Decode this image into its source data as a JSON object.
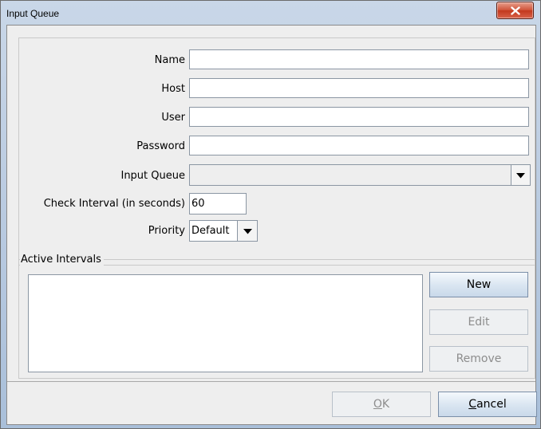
{
  "window": {
    "title": "Input Queue",
    "close_icon": "close-x-icon"
  },
  "form": {
    "name_label": "Name",
    "name_value": "",
    "host_label": "Host",
    "host_value": "",
    "user_label": "User",
    "user_value": "",
    "password_label": "Password",
    "password_value": "",
    "input_queue_label": "Input Queue",
    "input_queue_value": "",
    "check_interval_label": "Check Interval (in seconds)",
    "check_interval_value": "60",
    "priority_label": "Priority",
    "priority_value": "Default"
  },
  "intervals": {
    "title": "Active Intervals",
    "items": [],
    "new_label": "New",
    "edit_label": "Edit",
    "remove_label": "Remove"
  },
  "footer": {
    "ok_mnemonic": "O",
    "ok_rest": "K",
    "cancel_mnemonic": "C",
    "cancel_rest": "ancel"
  },
  "colors": {
    "close_button": "#c2381d",
    "dialog_background": "#eeeeee",
    "disabled_text": "#8d8d8d"
  }
}
